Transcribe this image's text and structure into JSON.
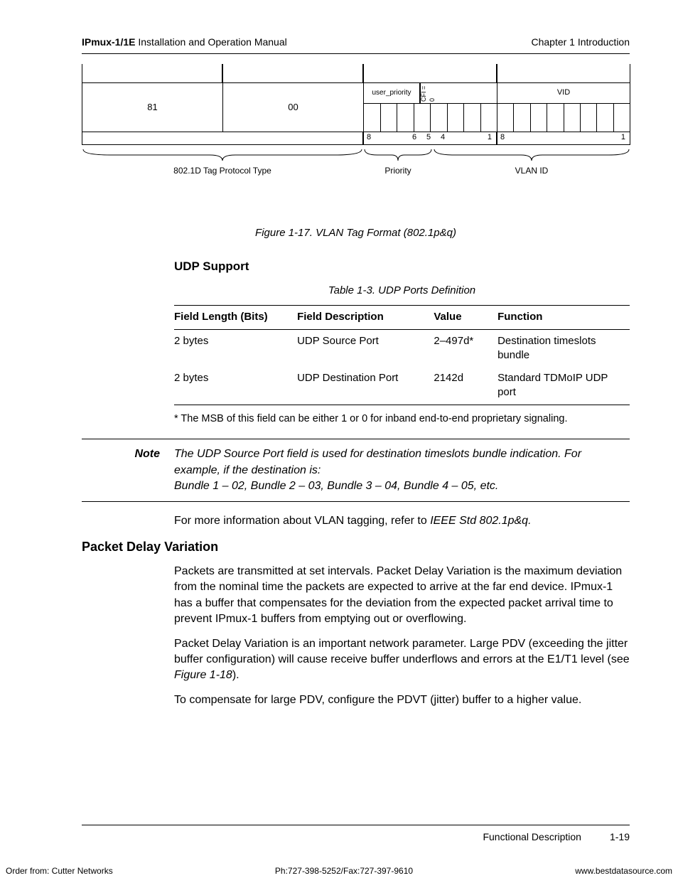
{
  "header": {
    "product": "IPmux-1/1E",
    "manual": " Installation and Operation Manual",
    "chapter": "Chapter 1  Introduction"
  },
  "diagram": {
    "byte1": "81",
    "byte2": "00",
    "user_priority": "user_priority",
    "cfi": "CFI = 0",
    "vid": "VID",
    "ticks": {
      "n8": "8",
      "n6": "6",
      "n5": "5",
      "n4": "4",
      "n1": "1",
      "n8b": "8",
      "n1b": "1"
    },
    "brace1": "802.1D Tag Protocol Type",
    "brace2": "Priority",
    "brace3": "VLAN ID",
    "caption": "Figure 1-17.  VLAN Tag Format (802.1p&q)"
  },
  "udp": {
    "heading": "UDP Support",
    "table_caption": "Table 1-3.  UDP Ports Definition",
    "headers": [
      "Field Length (Bits)",
      "Field Description",
      "Value",
      "Function"
    ],
    "rows": [
      [
        "2 bytes",
        "UDP Source Port",
        "2–497d*",
        "Destination timeslots bundle"
      ],
      [
        "2 bytes",
        "UDP Destination Port",
        "2142d",
        "Standard TDMoIP UDP port"
      ]
    ],
    "footnote": "* The MSB of this field can be either 1 or 0 for inband end-to-end proprietary signaling."
  },
  "note": {
    "label": "Note",
    "line1": "The UDP Source Port field is used for destination timeslots bundle indication. For example, if the destination is:",
    "line2": "Bundle 1 – 02, Bundle 2 – 03, Bundle 3 – 04, Bundle 4 – 05, etc."
  },
  "vlan_ref_pre": "For more information about VLAN tagging, refer to ",
  "vlan_ref_em": "IEEE Std 802.1p&q.",
  "pdv": {
    "heading": "Packet Delay Variation",
    "p1": "Packets are transmitted at set intervals. Packet Delay Variation is the maximum deviation from the nominal time the packets are expected to arrive at the far end device. IPmux-1 has a buffer that compensates for the deviation from the expected packet arrival time to prevent IPmux-1 buffers from emptying out or overflowing.",
    "p2_pre": "Packet Delay Variation is an important network parameter. Large PDV (exceeding the jitter buffer configuration) will cause receive buffer underflows and errors at the E1/T1 level (see ",
    "p2_em": "Figure 1-18",
    "p2_post": ").",
    "p3": "To compensate for large PDV, configure the PDVT (jitter) buffer to a higher value."
  },
  "footer": {
    "section": "Functional Description",
    "page": "1-19"
  },
  "very_bottom": {
    "left": "Order from: Cutter Networks",
    "mid": "Ph:727-398-5252/Fax:727-397-9610",
    "right": "www.bestdatasource.com"
  }
}
